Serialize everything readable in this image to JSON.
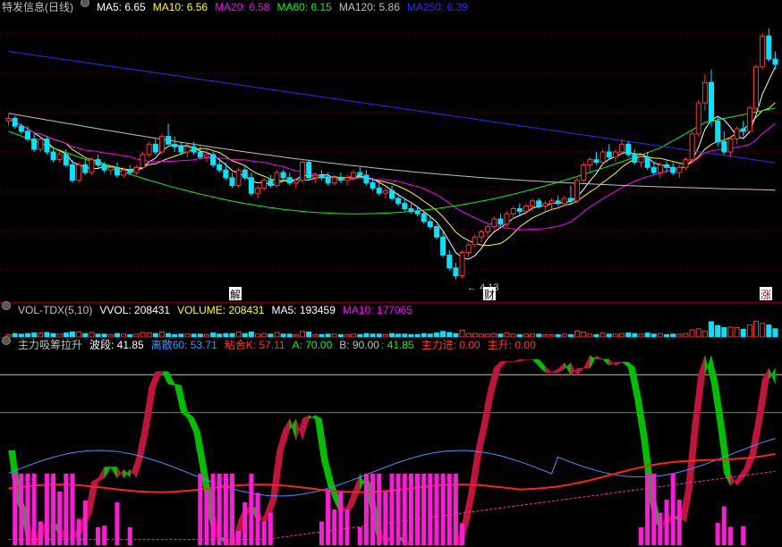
{
  "price_panel": {
    "title": "特发信息(日线)",
    "indicators": [
      {
        "label": "MA5: 6.65",
        "color": "#ffffff"
      },
      {
        "label": "MA10: 6.56",
        "color": "#ffff00"
      },
      {
        "label": "MA20: 6.58",
        "color": "#ff00ff"
      },
      {
        "label": "MA60: 6.15",
        "color": "#00ff00"
      },
      {
        "label": "MA120: 5.86",
        "color": "#c0c0c0"
      },
      {
        "label": "MA250: 6.39",
        "color": "#0000ff"
      }
    ],
    "low_annotation": "4.13",
    "markers": [
      "解",
      "财",
      "涨"
    ]
  },
  "volume_panel": {
    "title": "VOL-TDX(5,10)",
    "indicators": [
      {
        "label": "VVOL: 208431",
        "color": "#ffffff"
      },
      {
        "label": "VOLUME: 208431",
        "color": "#ffff00"
      },
      {
        "label": "MA5: 193459",
        "color": "#ffffff"
      },
      {
        "label": "MA10: 177065",
        "color": "#ff00ff"
      }
    ]
  },
  "indicator_panel": {
    "title": "主力吸筹拉升",
    "indicators": [
      {
        "label": "波段: 41.85",
        "color": "#ffffff"
      },
      {
        "label": "离散60: 53.71",
        "color": "#3399ff"
      },
      {
        "label": "粘合K: 57.11",
        "color": "#ff3333"
      },
      {
        "label": "A: 70.00",
        "color": "#00ff00"
      },
      {
        "label": "B: 90.00",
        "color": "#c0c0c0"
      },
      {
        "label": ": 41.85",
        "color": "#00ff00"
      },
      {
        "label": "主力进: 0.00",
        "color": "#ff3333"
      },
      {
        "label": "主升: 0.00",
        "color": "#ff3333"
      }
    ]
  },
  "colors": {
    "up": "#ff3232",
    "down": "#00e5ff",
    "grid": "#7a0000"
  },
  "chart_data": {
    "type": "candlestick",
    "ma_lines": [
      "MA5",
      "MA10",
      "MA20",
      "MA60",
      "MA120",
      "MA250"
    ],
    "candles": [
      [
        7.2,
        7.35,
        7.1,
        7.25
      ],
      [
        7.25,
        7.3,
        7.05,
        7.1
      ],
      [
        7.1,
        7.15,
        6.95,
        7.0
      ],
      [
        7.0,
        7.1,
        6.8,
        6.85
      ],
      [
        6.85,
        6.95,
        6.6,
        6.65
      ],
      [
        6.65,
        6.9,
        6.6,
        6.85
      ],
      [
        6.85,
        6.9,
        6.55,
        6.6
      ],
      [
        6.6,
        6.7,
        6.4,
        6.45
      ],
      [
        6.45,
        6.6,
        6.4,
        6.55
      ],
      [
        6.55,
        6.65,
        6.3,
        6.35
      ],
      [
        6.35,
        6.45,
        6.0,
        6.05
      ],
      [
        6.05,
        6.4,
        6.0,
        6.35
      ],
      [
        6.35,
        6.45,
        6.15,
        6.2
      ],
      [
        6.2,
        6.5,
        6.15,
        6.45
      ],
      [
        6.45,
        6.55,
        6.3,
        6.35
      ],
      [
        6.35,
        6.4,
        6.2,
        6.25
      ],
      [
        6.25,
        6.35,
        6.15,
        6.3
      ],
      [
        6.3,
        6.4,
        6.1,
        6.15
      ],
      [
        6.15,
        6.3,
        6.1,
        6.25
      ],
      [
        6.25,
        6.35,
        6.15,
        6.2
      ],
      [
        6.2,
        6.35,
        6.15,
        6.3
      ],
      [
        6.3,
        6.6,
        6.25,
        6.55
      ],
      [
        6.55,
        6.8,
        6.5,
        6.75
      ],
      [
        6.75,
        6.85,
        6.55,
        6.6
      ],
      [
        6.6,
        6.95,
        6.55,
        6.9
      ],
      [
        6.9,
        7.15,
        6.85,
        6.75
      ],
      [
        6.75,
        6.9,
        6.6,
        6.7
      ],
      [
        6.7,
        6.8,
        6.55,
        6.6
      ],
      [
        6.6,
        6.75,
        6.5,
        6.7
      ],
      [
        6.7,
        6.8,
        6.55,
        6.6
      ],
      [
        6.6,
        6.7,
        6.45,
        6.5
      ],
      [
        6.5,
        6.65,
        6.4,
        6.55
      ],
      [
        6.55,
        6.6,
        6.3,
        6.35
      ],
      [
        6.35,
        6.45,
        6.2,
        6.25
      ],
      [
        6.25,
        6.4,
        6.05,
        6.1
      ],
      [
        6.1,
        6.2,
        5.9,
        5.95
      ],
      [
        5.95,
        6.3,
        5.9,
        6.25
      ],
      [
        6.25,
        6.35,
        6.05,
        6.1
      ],
      [
        6.1,
        6.2,
        5.75,
        5.8
      ],
      [
        5.8,
        5.95,
        5.7,
        5.9
      ],
      [
        5.9,
        6.1,
        5.85,
        6.05
      ],
      [
        6.05,
        6.15,
        5.9,
        5.95
      ],
      [
        5.95,
        6.25,
        5.9,
        6.2
      ],
      [
        6.2,
        6.25,
        6.05,
        6.1
      ],
      [
        6.1,
        6.2,
        5.95,
        6.0
      ],
      [
        6.0,
        6.1,
        5.9,
        6.05
      ],
      [
        6.05,
        6.45,
        6.0,
        6.4
      ],
      [
        6.4,
        6.45,
        6.05,
        6.1
      ],
      [
        6.1,
        6.2,
        6.0,
        6.15
      ],
      [
        6.15,
        6.25,
        6.05,
        6.1
      ],
      [
        6.1,
        6.2,
        5.95,
        6.0
      ],
      [
        6.0,
        6.15,
        5.95,
        6.1
      ],
      [
        6.1,
        6.2,
        6.0,
        6.05
      ],
      [
        6.05,
        6.15,
        5.95,
        6.1
      ],
      [
        6.1,
        6.25,
        6.05,
        6.2
      ],
      [
        6.2,
        6.3,
        6.1,
        6.15
      ],
      [
        6.15,
        6.25,
        5.95,
        6.0
      ],
      [
        6.0,
        6.1,
        5.85,
        5.9
      ],
      [
        5.9,
        6.0,
        5.75,
        5.8
      ],
      [
        5.8,
        5.9,
        5.7,
        5.85
      ],
      [
        5.85,
        5.95,
        5.65,
        5.7
      ],
      [
        5.7,
        5.8,
        5.55,
        5.6
      ],
      [
        5.6,
        5.7,
        5.45,
        5.5
      ],
      [
        5.5,
        5.6,
        5.4,
        5.45
      ],
      [
        5.45,
        5.55,
        5.35,
        5.4
      ],
      [
        5.4,
        5.45,
        5.2,
        5.25
      ],
      [
        5.25,
        5.35,
        5.1,
        5.15
      ],
      [
        5.15,
        5.2,
        4.9,
        4.95
      ],
      [
        4.95,
        5.05,
        4.55,
        4.6
      ],
      [
        4.6,
        4.7,
        4.3,
        4.35
      ],
      [
        4.35,
        4.45,
        4.13,
        4.2
      ],
      [
        4.2,
        4.7,
        4.15,
        4.65
      ],
      [
        4.65,
        4.85,
        4.55,
        4.8
      ],
      [
        4.8,
        5.0,
        4.75,
        4.95
      ],
      [
        4.95,
        5.1,
        4.85,
        5.05
      ],
      [
        5.05,
        5.2,
        4.95,
        5.15
      ],
      [
        5.15,
        5.35,
        5.1,
        5.3
      ],
      [
        5.3,
        5.4,
        5.15,
        5.2
      ],
      [
        5.2,
        5.45,
        5.15,
        5.4
      ],
      [
        5.4,
        5.55,
        5.3,
        5.5
      ],
      [
        5.5,
        5.6,
        5.35,
        5.45
      ],
      [
        5.45,
        5.6,
        5.4,
        5.55
      ],
      [
        5.55,
        5.7,
        5.45,
        5.65
      ],
      [
        5.65,
        5.7,
        5.5,
        5.55
      ],
      [
        5.55,
        5.65,
        5.45,
        5.6
      ],
      [
        5.6,
        5.7,
        5.5,
        5.65
      ],
      [
        5.65,
        5.75,
        5.55,
        5.6
      ],
      [
        5.6,
        5.75,
        5.55,
        5.7
      ],
      [
        5.7,
        5.95,
        5.6,
        5.65
      ],
      [
        5.65,
        6.1,
        5.6,
        6.05
      ],
      [
        6.05,
        6.4,
        6.0,
        6.35
      ],
      [
        6.35,
        6.5,
        6.2,
        6.45
      ],
      [
        6.45,
        6.6,
        6.35,
        6.4
      ],
      [
        6.4,
        6.65,
        6.35,
        6.6
      ],
      [
        6.6,
        6.75,
        6.45,
        6.5
      ],
      [
        6.5,
        6.65,
        6.4,
        6.6
      ],
      [
        6.6,
        6.85,
        6.55,
        6.75
      ],
      [
        6.75,
        6.8,
        6.5,
        6.55
      ],
      [
        6.55,
        6.65,
        6.35,
        6.4
      ],
      [
        6.4,
        6.55,
        6.3,
        6.5
      ],
      [
        6.5,
        6.6,
        6.25,
        6.3
      ],
      [
        6.3,
        6.4,
        6.15,
        6.2
      ],
      [
        6.2,
        6.4,
        6.1,
        6.35
      ],
      [
        6.35,
        6.45,
        6.2,
        6.3
      ],
      [
        6.3,
        6.4,
        6.15,
        6.2
      ],
      [
        6.2,
        6.35,
        6.1,
        6.3
      ],
      [
        6.3,
        6.5,
        6.25,
        6.45
      ],
      [
        6.45,
        7.0,
        6.4,
        6.95
      ],
      [
        6.95,
        7.6,
        6.9,
        7.55
      ],
      [
        7.55,
        8.1,
        7.4,
        7.95
      ],
      [
        7.95,
        8.2,
        7.1,
        7.2
      ],
      [
        7.2,
        7.3,
        6.7,
        6.8
      ],
      [
        6.8,
        7.0,
        6.55,
        6.6
      ],
      [
        6.6,
        6.9,
        6.5,
        6.85
      ],
      [
        6.85,
        7.1,
        6.75,
        7.05
      ],
      [
        7.05,
        7.2,
        6.9,
        7.0
      ],
      [
        7.0,
        7.5,
        6.95,
        7.45
      ],
      [
        7.45,
        8.3,
        7.4,
        8.25
      ],
      [
        8.25,
        8.9,
        8.2,
        8.85
      ],
      [
        8.85,
        9.0,
        8.35,
        8.4
      ],
      [
        8.4,
        8.55,
        8.2,
        8.3
      ]
    ],
    "y_range": [
      4.0,
      9.2
    ]
  }
}
